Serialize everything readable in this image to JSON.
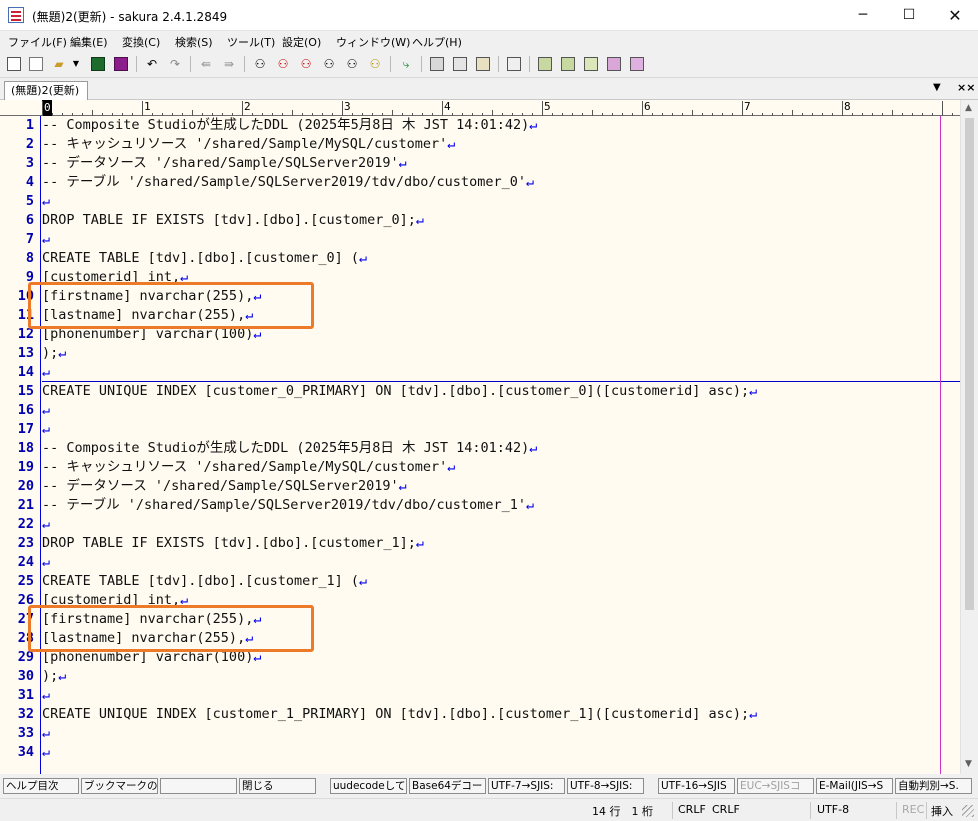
{
  "window": {
    "title": "(無題)2(更新) - sakura 2.4.1.2849",
    "minimize": "─",
    "maximize": "☐",
    "close": "✕"
  },
  "menu": [
    "ファイル(F)",
    "編集(E)",
    "変換(C)",
    "検索(S)",
    "ツール(T)",
    "設定(O)",
    "ウィンドウ(W)",
    "ヘルプ(H)"
  ],
  "toolbar_icons": [
    "new-window-icon",
    "new-file-icon",
    "open-file-icon",
    "dropdown-arrow-icon",
    "save-icon",
    "save-all-icon",
    "undo-icon",
    "redo-icon",
    "jump-back-icon",
    "jump-forward-icon",
    "search-icon",
    "search-previous-icon",
    "search-next-icon",
    "replace-icon",
    "search-marker-icon",
    "grep-icon",
    "outline-icon",
    "print-icon",
    "print-preview-icon",
    "print-setup-icon",
    "font-icon",
    "common-settings-icon",
    "type-settings-icon",
    "window-cascade-icon",
    "window-tile-icon",
    "window-split-icon",
    "window-close-icon"
  ],
  "tab": {
    "label": "(無題)2(更新)",
    "dropdown": "▼",
    "close": "××"
  },
  "ruler": {
    "marks": [
      "0",
      "1",
      "2",
      "3",
      "4",
      "5",
      "6",
      "7",
      "8"
    ]
  },
  "editor": {
    "eol_mark": "↵",
    "cursor_line": 14,
    "lines": [
      "-- Composite Studioが生成したDDL (2025年5月8日 木 JST 14:01:42)",
      "-- キャッシュリソース '/shared/Sample/MySQL/customer'",
      "-- データソース '/shared/Sample/SQLServer2019'",
      "-- テーブル '/shared/Sample/SQLServer2019/tdv/dbo/customer_0'",
      "",
      "DROP TABLE IF EXISTS [tdv].[dbo].[customer_0];",
      "",
      "CREATE TABLE [tdv].[dbo].[customer_0] (",
      "[customerid] int,",
      "[firstname] nvarchar(255),",
      "[lastname] nvarchar(255),",
      "[phonenumber] varchar(100)",
      ");",
      "",
      "CREATE UNIQUE INDEX [customer_0_PRIMARY] ON [tdv].[dbo].[customer_0]([customerid] asc);",
      "",
      "",
      "-- Composite Studioが生成したDDL (2025年5月8日 木 JST 14:01:42)",
      "-- キャッシュリソース '/shared/Sample/MySQL/customer'",
      "-- データソース '/shared/Sample/SQLServer2019'",
      "-- テーブル '/shared/Sample/SQLServer2019/tdv/dbo/customer_1'",
      "",
      "DROP TABLE IF EXISTS [tdv].[dbo].[customer_1];",
      "",
      "CREATE TABLE [tdv].[dbo].[customer_1] (",
      "[customerid] int,",
      "[firstname] nvarchar(255),",
      "[lastname] nvarchar(255),",
      "[phonenumber] varchar(100)",
      ");",
      "",
      "CREATE UNIQUE INDEX [customer_1_PRIMARY] ON [tdv].[dbo].[customer_1]([customerid] asc);",
      "",
      ""
    ]
  },
  "highlights": [
    {
      "first_line": 10,
      "last_line": 11
    },
    {
      "first_line": 27,
      "last_line": 28
    }
  ],
  "function_keys": [
    {
      "label": "ヘルプ目次",
      "enabled": true
    },
    {
      "label": "ブックマークの",
      "enabled": true
    },
    {
      "label": "",
      "enabled": true
    },
    {
      "label": "閉じる",
      "enabled": true
    },
    {
      "label": "uudecodeして(",
      "enabled": true
    },
    {
      "label": "Base64デコー",
      "enabled": true
    },
    {
      "label": "UTF-7→SJIS:",
      "enabled": true
    },
    {
      "label": "UTF-8→SJIS:",
      "enabled": true
    },
    {
      "label": "UTF-16→SJIS",
      "enabled": true
    },
    {
      "label": "EUC→SJISコ",
      "enabled": false
    },
    {
      "label": "E-Mail(JIS→S",
      "enabled": true
    },
    {
      "label": "自動判別→S.",
      "enabled": true
    }
  ],
  "status": {
    "position": "14 行　1 桁",
    "eol_type": "CRLF",
    "eol_type2": "CRLF",
    "encoding": "UTF-8",
    "rec": "REC",
    "mode": "挿入"
  },
  "colors": {
    "editor_bg": "#fffbf0",
    "line_number": "#0000b0",
    "eol_mark": "#0000ee",
    "highlight_box": "#ec7a28",
    "wrap_line": "#cc33cc"
  }
}
